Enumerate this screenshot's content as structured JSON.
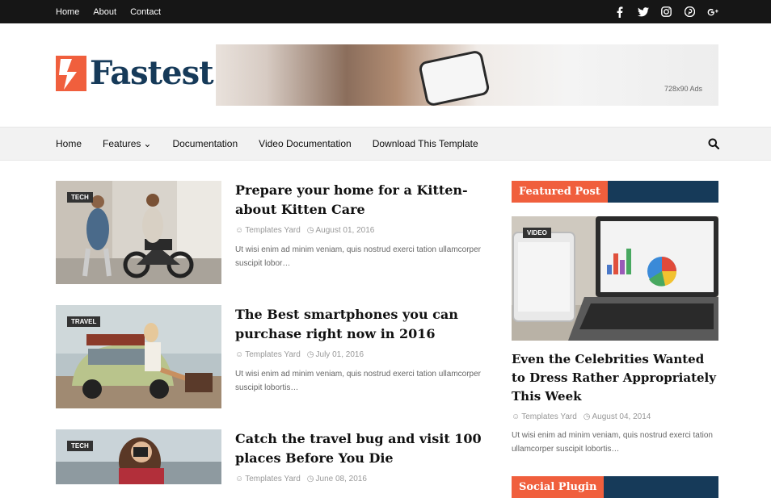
{
  "topbar": {
    "links": [
      "Home",
      "About",
      "Contact"
    ],
    "social_icons": [
      "facebook-icon",
      "twitter-icon",
      "instagram-icon",
      "pinterest-icon",
      "google-plus-icon"
    ]
  },
  "header": {
    "logo_text": "Fastest",
    "ad_label": "728x90 Ads"
  },
  "nav": {
    "items": [
      "Home",
      "Features",
      "Documentation",
      "Video Documentation",
      "Download This Template"
    ],
    "features_has_dropdown": true
  },
  "posts": [
    {
      "badge": "TECH",
      "title": "Prepare your home for a Kitten-about Kitten Care",
      "author": "Templates Yard",
      "date": "August 01, 2016",
      "snippet": "Ut wisi enim ad minim veniam, quis nostrud exerci tation ullamcorper suscipit lobor…"
    },
    {
      "badge": "TRAVEL",
      "title": "The Best smartphones you can purchase right now in 2016",
      "author": "Templates Yard",
      "date": "July 01, 2016",
      "snippet": "Ut wisi enim ad minim veniam, quis nostrud exerci tation ullamcorper suscipit lobortis…"
    },
    {
      "badge": "TECH",
      "title": "Catch the travel bug and visit 100 places Before You Die",
      "author": "Templates Yard",
      "date": "June 08, 2016",
      "snippet": ""
    }
  ],
  "sidebar": {
    "featured_heading": "Featured Post",
    "featured": {
      "badge": "VIDEO",
      "title": "Even the Celebrities Wanted to Dress Rather Appropriately This Week",
      "author": "Templates Yard",
      "date": "August 04, 2014",
      "snippet": "Ut wisi enim ad minim veniam, quis nostrud exerci tation ullamcorper suscipit lobortis…"
    },
    "second_heading": "Social Plugin"
  },
  "colors": {
    "accent": "#f05f3d",
    "navy": "#163a59",
    "topbar": "#161616"
  }
}
